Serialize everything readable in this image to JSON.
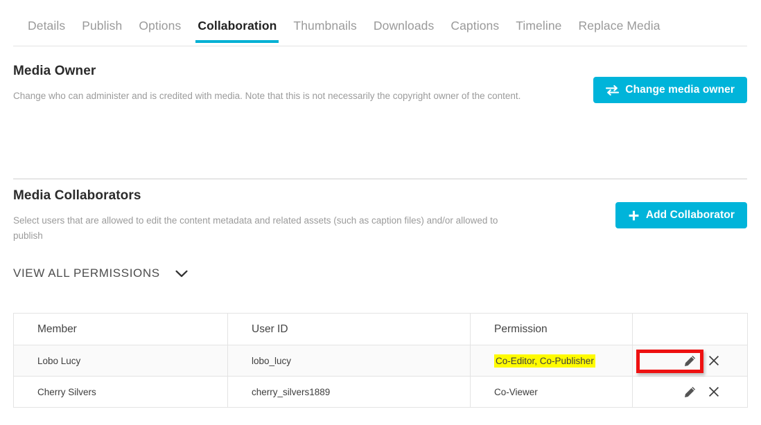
{
  "tabs": [
    {
      "label": "Details",
      "active": false
    },
    {
      "label": "Publish",
      "active": false
    },
    {
      "label": "Options",
      "active": false
    },
    {
      "label": "Collaboration",
      "active": true
    },
    {
      "label": "Thumbnails",
      "active": false
    },
    {
      "label": "Downloads",
      "active": false
    },
    {
      "label": "Captions",
      "active": false
    },
    {
      "label": "Timeline",
      "active": false
    },
    {
      "label": "Replace Media",
      "active": false
    }
  ],
  "media_owner": {
    "title": "Media Owner",
    "description": "Change who can administer and is credited with media. Note that this is not necessarily the copyright owner of the content.",
    "button_label": "Change media owner",
    "button_icon": "swap-arrows-icon"
  },
  "media_collaborators": {
    "title": "Media Collaborators",
    "description": "Select users that are allowed to edit the content metadata and related assets (such as caption files) and/or allowed to publish",
    "button_label": "Add Collaborator",
    "button_icon": "plus-icon",
    "view_all_permissions_label": "VIEW ALL PERMISSIONS",
    "view_all_permissions_icon": "chevron-down-icon",
    "table": {
      "headers": [
        "Member",
        "User ID",
        "Permission",
        ""
      ],
      "rows": [
        {
          "member": "Lobo Lucy",
          "user_id": "lobo_lucy",
          "permission": "Co-Editor, Co-Publisher",
          "permission_highlighted": true,
          "edit_icon": "pencil-icon",
          "delete_icon": "x-icon"
        },
        {
          "member": "Cherry Silvers",
          "user_id": "cherry_silvers1889",
          "permission": "Co-Viewer",
          "permission_highlighted": false,
          "edit_icon": "pencil-icon",
          "delete_icon": "x-icon"
        }
      ]
    }
  },
  "colors": {
    "accent": "#00b4da",
    "active_tab_underline": "#00b0d4",
    "highlight": "#fffb00",
    "annotation": "#ee1111",
    "muted_text": "#9b9b9b"
  }
}
